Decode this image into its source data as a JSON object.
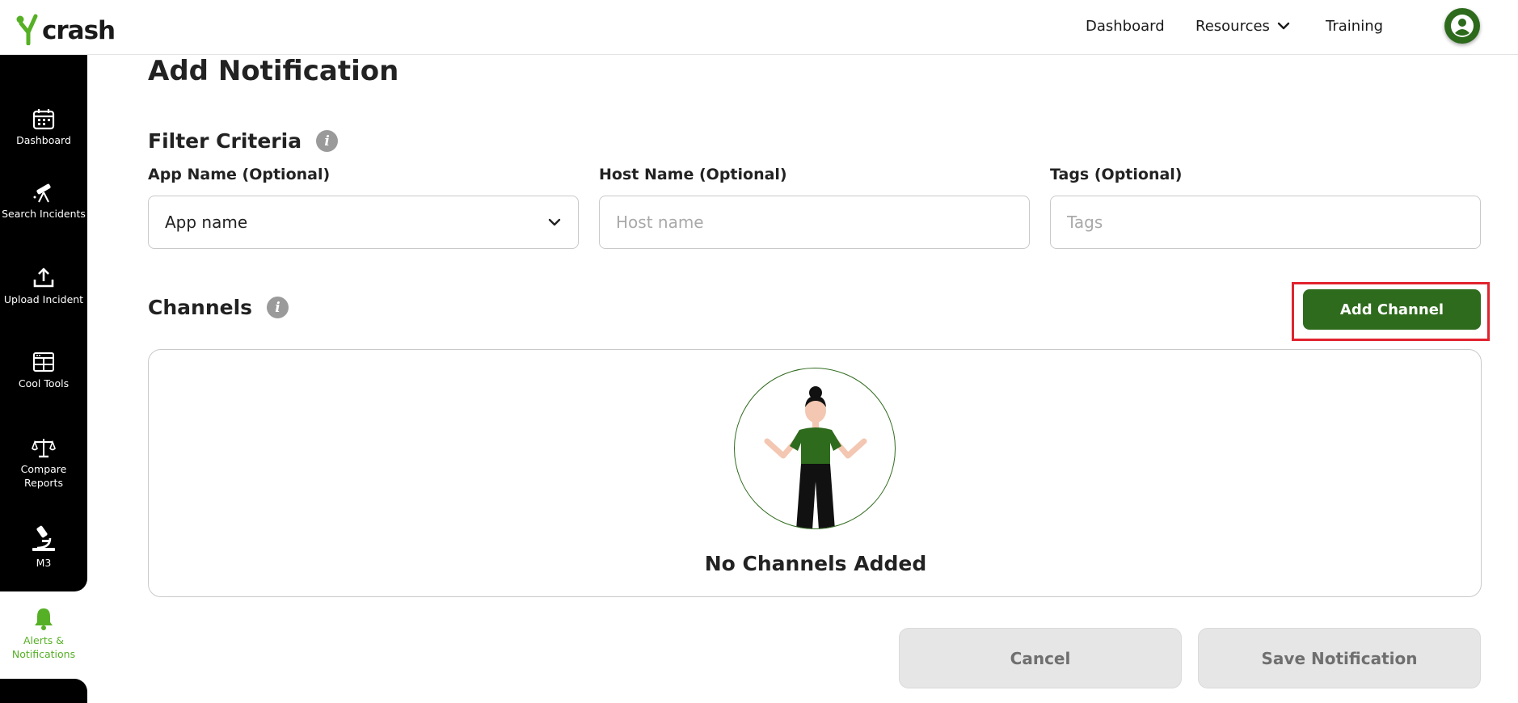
{
  "header": {
    "logo_text": "crash",
    "nav": {
      "dashboard": "Dashboard",
      "resources": "Resources",
      "training": "Training"
    }
  },
  "sidebar": {
    "items": [
      {
        "label": "Dashboard",
        "icon": "calendar-icon"
      },
      {
        "label": "Search Incidents",
        "icon": "telescope-icon"
      },
      {
        "label": "Upload Incident",
        "icon": "upload-icon"
      },
      {
        "label": "Cool Tools",
        "icon": "grid-icon"
      },
      {
        "label": "Compare Reports",
        "icon": "scales-icon"
      },
      {
        "label": "M3",
        "icon": "microscope-icon"
      },
      {
        "label": "Alerts & Notifications",
        "icon": "bell-icon",
        "active": true
      }
    ]
  },
  "page": {
    "title": "Add Notification",
    "filter_criteria": {
      "title": "Filter Criteria",
      "app_name": {
        "label": "App Name (Optional)",
        "value": "App name"
      },
      "host_name": {
        "label": "Host Name (Optional)",
        "placeholder": "Host name",
        "value": ""
      },
      "tags": {
        "label": "Tags (Optional)",
        "placeholder": "Tags",
        "value": ""
      }
    },
    "channels": {
      "title": "Channels",
      "add_button": "Add Channel",
      "empty_text": "No Channels Added"
    },
    "footer": {
      "cancel": "Cancel",
      "save": "Save Notification"
    }
  },
  "colors": {
    "brand_green": "#2f6b1d",
    "active_green": "#56b026",
    "highlight_red": "#e0232e",
    "sidebar_bg": "#000000"
  }
}
